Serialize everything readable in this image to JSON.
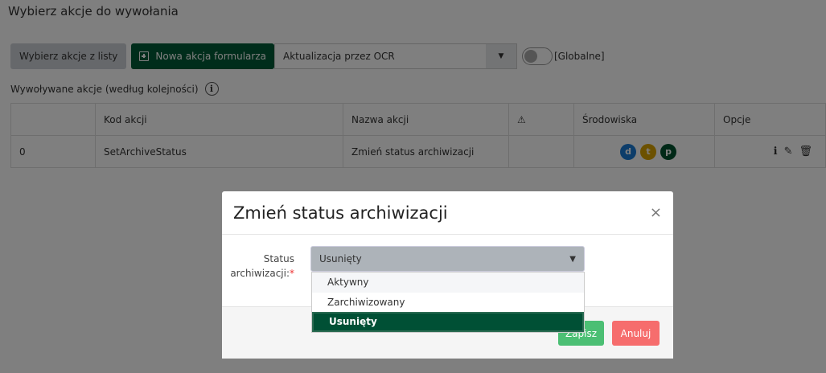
{
  "page": {
    "title": "Wybierz akcje do wywołania"
  },
  "toolbar": {
    "choose_label": "Wybierz akcje z listy",
    "new_label": "Nowa akcja formularza",
    "select_value": "Aktualizacja przez OCR",
    "toggle_label": "[Globalne]",
    "toggle_on": false
  },
  "subtitle": "Wywoływane akcje (według kolejności)",
  "table": {
    "headers": [
      "",
      "Kod akcji",
      "Nazwa akcji",
      "⚠",
      "Środowiska",
      "Opcje"
    ],
    "rows": [
      {
        "order": "0",
        "code": "SetArchiveStatus",
        "name": "Zmień status archiwizacji",
        "env": [
          "d",
          "t",
          "p"
        ]
      }
    ]
  },
  "env_colors": {
    "d": "#1a7ad4",
    "t": "#d9a300",
    "p": "#00522f"
  },
  "modal": {
    "title": "Zmień status archiwizacji",
    "close": "×",
    "field_label": "Status archiwizacji:",
    "required": "*",
    "select_value": "Usunięty",
    "options": [
      "Aktywny",
      "Zarchiwizowany",
      "Usunięty"
    ],
    "save": "Zapisz",
    "cancel": "Anuluj"
  }
}
